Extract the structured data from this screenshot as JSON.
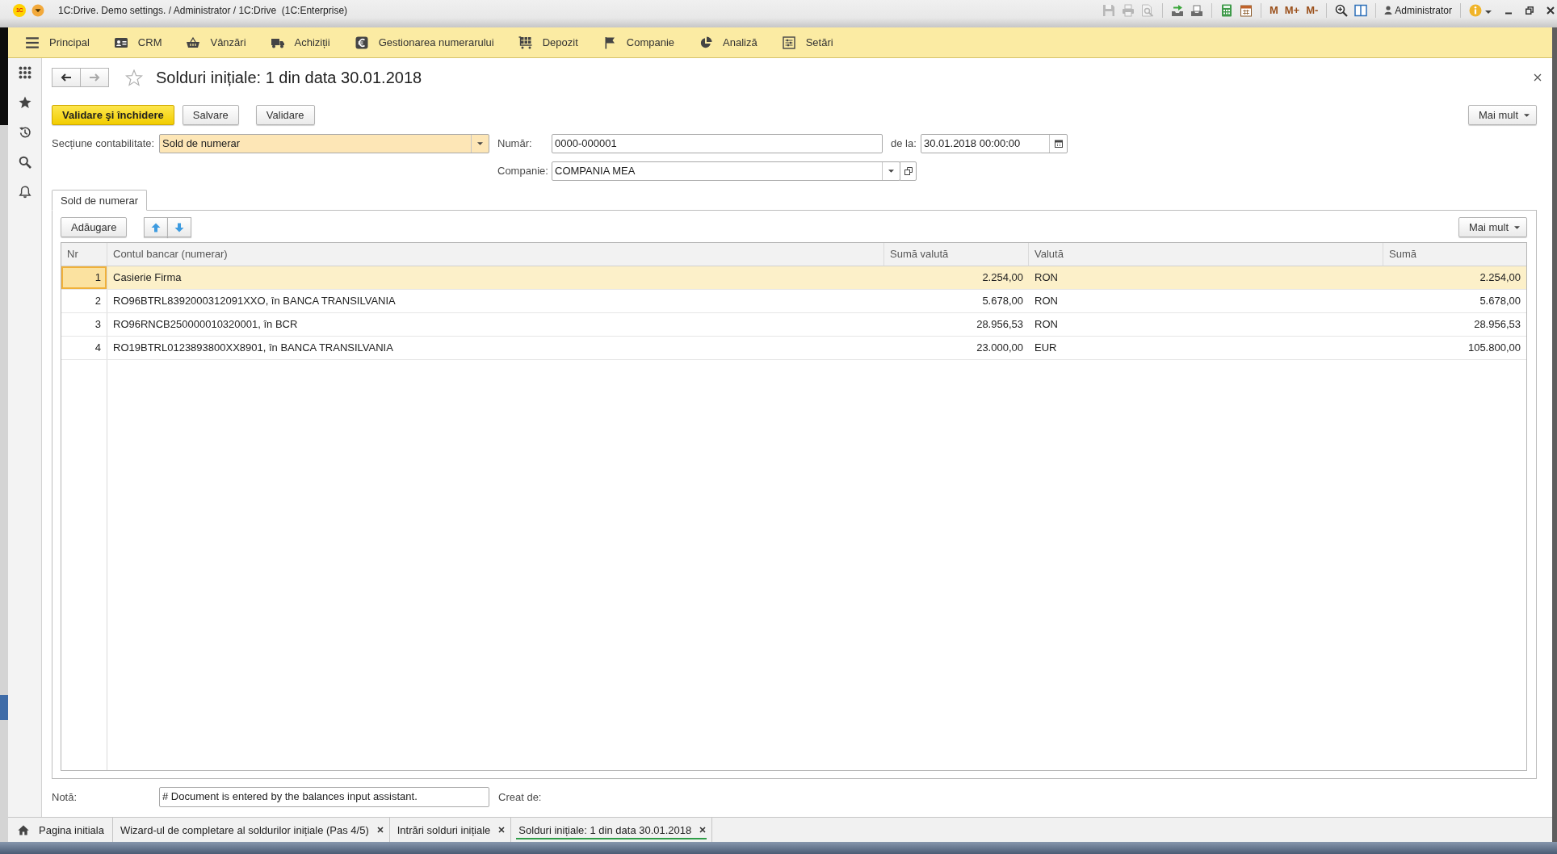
{
  "window": {
    "logo": "1C",
    "title": "1C:Drive. Demo settings. / Administrator / 1C:Drive  (1C:Enterprise)",
    "tool_groups": [
      [
        {
          "kind": "icon",
          "disabled": true
        },
        {
          "kind": "icon",
          "disabled": true
        },
        {
          "kind": "icon",
          "disabled": true
        }
      ],
      [
        {
          "kind": "icon",
          "disabled": false
        },
        {
          "kind": "icon",
          "disabled": false
        }
      ],
      [
        {
          "kind": "icon",
          "disabled": false
        },
        {
          "kind": "icon",
          "disabled": false
        }
      ],
      [
        {
          "kind": "text",
          "label": "M",
          "disabled": false
        },
        {
          "kind": "text",
          "label": "M+",
          "disabled": false
        },
        {
          "kind": "text",
          "label": "M-",
          "disabled": false
        }
      ],
      [
        {
          "kind": "icon",
          "disabled": false
        },
        {
          "kind": "icon",
          "disabled": false
        }
      ]
    ],
    "user": "Administrator"
  },
  "sections": [
    {
      "label": "Principal"
    },
    {
      "label": "CRM"
    },
    {
      "label": "Vânzări"
    },
    {
      "label": "Achiziții"
    },
    {
      "label": "Gestionarea numerarului"
    },
    {
      "label": "Depozit"
    },
    {
      "label": "Companie"
    },
    {
      "label": "Analiză"
    },
    {
      "label": "Setări"
    }
  ],
  "form": {
    "history_buttons": [
      {
        "disabled": false
      },
      {
        "disabled": true
      }
    ],
    "favorite": false,
    "title": "Solduri inițiale: 1 din data 30.01.2018",
    "commands": [
      {
        "label": "Validare şi închidere",
        "default": true
      },
      {
        "label": "Salvare",
        "default": false
      },
      {
        "label": "Validare",
        "default": false
      }
    ],
    "more": "Mai mult",
    "accounting_section": {
      "label": "Secțiune contabilitate:",
      "value": "Sold de numerar",
      "highlighted": true
    },
    "number": {
      "label": "Număr:",
      "value": "0000-000001"
    },
    "date": {
      "label": "de la:",
      "value": "30.01.2018 00:00:00"
    },
    "company": {
      "label": "Companie:",
      "value": "COMPANIA MEA"
    },
    "tabs": [
      {
        "label": "Sold de numerar",
        "selected": true
      }
    ],
    "table_toolbar": {
      "add": "Adăugare",
      "more": "Mai mult"
    },
    "table": {
      "columns": [
        "Nr",
        "Contul bancar (numerar)",
        "Sumă valută",
        "Valută",
        "Sumă"
      ],
      "rows": [
        {
          "selected": true,
          "cells": [
            "1",
            "Casierie Firma",
            "2.254,00",
            "RON",
            "2.254,00"
          ]
        },
        {
          "selected": false,
          "cells": [
            "2",
            "RO96BTRL8392000312091XXO, în BANCA TRANSILVANIA",
            "5.678,00",
            "RON",
            "5.678,00"
          ]
        },
        {
          "selected": false,
          "cells": [
            "3",
            "RO96RNCB250000010320001, în BCR",
            "28.956,53",
            "RON",
            "28.956,53"
          ]
        },
        {
          "selected": false,
          "cells": [
            "4",
            "RO19BTRL0123893800XX8901, în BANCA TRANSILVANIA",
            "23.000,00",
            "EUR",
            "105.800,00"
          ]
        }
      ]
    },
    "note": {
      "label": "Notă:",
      "value": "# Document is entered by the balances input assistant."
    },
    "created_by": {
      "label": "Creat de:"
    }
  },
  "open_windows": [
    {
      "kind": "home",
      "label": "Pagina initiala",
      "selected": false
    },
    {
      "kind": "window",
      "label": "Wizard-ul de completare al soldurilor inițiale (Pas 4/5)",
      "selected": false
    },
    {
      "kind": "window",
      "label": "Intrări solduri inițiale",
      "selected": false
    },
    {
      "kind": "window",
      "label": "Solduri inițiale: 1 din data 30.01.2018",
      "selected": true
    }
  ]
}
